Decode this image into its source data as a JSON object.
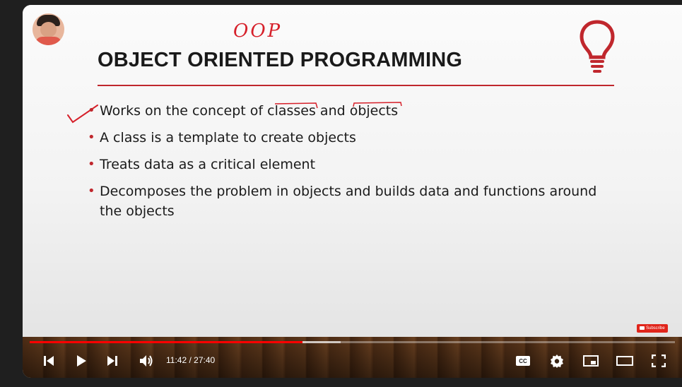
{
  "slide": {
    "annotation": "OOP",
    "title": "OBJECT ORIENTED PROGRAMMING",
    "bullets": [
      {
        "text": "Works on the concept of classes and objects"
      },
      {
        "text": "A class is a template to create objects"
      },
      {
        "text": "Treats data as a critical element"
      },
      {
        "text": "Decomposes the problem in objects and builds data and functions around the objects"
      }
    ],
    "accent_color": "#c0272d"
  },
  "subscribe_label": "Subscribe",
  "player": {
    "current_time": "11:42",
    "separator": " / ",
    "duration": "27:40",
    "progress_fraction": 0.4229,
    "buffered_fraction": 0.482,
    "progress_color": "#ff0000",
    "icons": {
      "previous": "previous-icon",
      "play": "play-icon",
      "next": "next-icon",
      "volume": "volume-icon",
      "captions": "captions-icon",
      "settings": "settings-gear-icon",
      "miniplayer": "miniplayer-icon",
      "theater": "theater-mode-icon",
      "fullscreen": "fullscreen-icon"
    },
    "captions_label": "CC"
  }
}
